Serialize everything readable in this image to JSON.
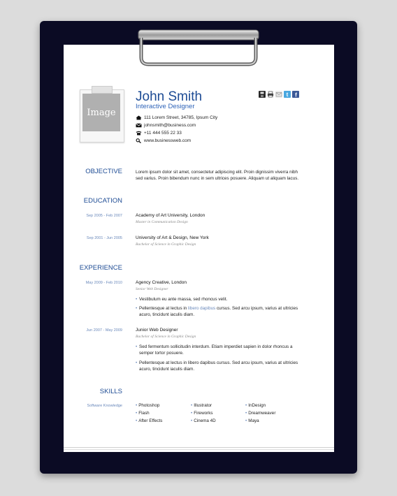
{
  "header": {
    "photo_label": "Image",
    "name": "John Smith",
    "title": "Interactive Designer",
    "contacts": [
      {
        "icon": "home-icon",
        "text": "111 Lorem Street, 34785, Ipsum City"
      },
      {
        "icon": "mail-icon",
        "text": "johnsmith@business.com"
      },
      {
        "icon": "phone-icon",
        "text": "+11 444 555 22 33"
      },
      {
        "icon": "search-icon",
        "text": "www.businessweb.com"
      }
    ],
    "share_icons": [
      "save-icon",
      "print-icon",
      "email-icon",
      "twitter-icon",
      "facebook-icon"
    ]
  },
  "objective": {
    "heading": "OBJECTIVE",
    "line1": "Lorem ipsum dolor sit amet, consectetur adipiscing elit. Proin dignissim viverra nibh",
    "line2": "sed varius. Proin bibendum nunc in sem ultrices posuere. Aliquam ut aliquam lacus."
  },
  "education": {
    "heading": "EDUCATION",
    "items": [
      {
        "date": "Sep 2005 - Feb 2007",
        "org": "Academy of Art University, London",
        "role": "Master in Communication Design"
      },
      {
        "date": "Sep 2001 - Jun 2005",
        "org": "University of Art & Design, New York",
        "role": "Bachelor of Science in Graphic Design"
      }
    ]
  },
  "experience": {
    "heading": "EXPERIENCE",
    "items": [
      {
        "date": "May 2009 - Feb 2010",
        "org": "Agency Creative, London",
        "role": "Senior Web Designer",
        "b1": "Vestibulum eu ante massa, sed rhoncus velit.",
        "b2_pre": "Pellentesque at lectus in ",
        "b2_hl": "libero dapibus",
        "b2_post": " cursus. Sed arcu ipsum, varius at ultricies",
        "b2_line2": "acuro, tincidunt iaculis diam."
      },
      {
        "date": "Jun 2007 - May 2009",
        "org": "Junior Web Designer",
        "role": "Bachelor of Science in Graphic Design",
        "b1": "Sed fermentum sollicitudin interdum. Etiam imperdiet sapien in dolor rhoncus a",
        "b1_line2": "semper tortor posuere.",
        "b2_pre": "Pellentesque at lectus in libero dapibus cursus. Sed arcu ipsum, varius at ultricies",
        "b2_line2": "acuro, tincidunt iaculis diam."
      }
    ]
  },
  "skills": {
    "heading": "SKILLS",
    "label": "Software Knowledge",
    "col1": [
      "Photoshop",
      "Flash",
      "After Effects"
    ],
    "col2": [
      "Illustrator",
      "Fireworks",
      "Cinema 4D"
    ],
    "col3": [
      "InDesign",
      "Dreamweaver",
      "Maya"
    ]
  },
  "colors": {
    "board": "#0b0b24",
    "accent": "#1d4b94",
    "date": "#6a89bb"
  }
}
